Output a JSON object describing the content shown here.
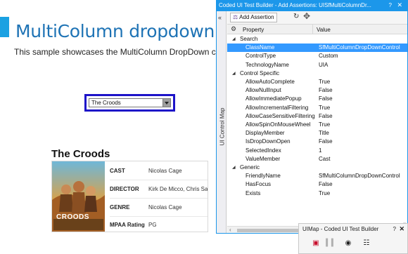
{
  "sample": {
    "title": "MultiColumn dropdown",
    "description": "This sample showcases the MultiColumn DropDown control.",
    "dropdown": {
      "selected_value": "The Croods"
    },
    "movie": {
      "title": "The Croods",
      "poster_text": "CROODS",
      "details": [
        {
          "key": "CAST",
          "value": "Nicolas Cage"
        },
        {
          "key": "DIRECTOR",
          "value": "Kirk De Micco, Chris Sanders"
        },
        {
          "key": "GENRE",
          "value": "Nicolas Cage"
        },
        {
          "key": "MPAA Rating",
          "value": "PG"
        }
      ]
    }
  },
  "builder": {
    "title": "Coded UI Test Builder - Add Assertions: UISfMultiColumnDr...",
    "help": "?",
    "close": "✕",
    "collapse": "«",
    "side_label": "UI Control Map",
    "toolbar": {
      "add_assertion": "Add Assertion"
    },
    "grid": {
      "col_property": "Property",
      "col_value": "Value",
      "rows": [
        {
          "kind": "cat",
          "label": "Search"
        },
        {
          "kind": "prop",
          "name": "ClassName",
          "value": "SfMultiColumnDropDownControl",
          "selected": true
        },
        {
          "kind": "prop",
          "name": "ControlType",
          "value": "Custom"
        },
        {
          "kind": "prop",
          "name": "TechnologyName",
          "value": "UIA"
        },
        {
          "kind": "cat",
          "label": "Control Specific"
        },
        {
          "kind": "prop",
          "name": "AllowAutoComplete",
          "value": "True"
        },
        {
          "kind": "prop",
          "name": "AllowNullInput",
          "value": "False"
        },
        {
          "kind": "prop",
          "name": "AllowImmediatePopup",
          "value": "False"
        },
        {
          "kind": "prop",
          "name": "AllowIncrementalFiltering",
          "value": "True"
        },
        {
          "kind": "prop",
          "name": "AllowCaseSensitiveFiltering",
          "value": "False"
        },
        {
          "kind": "prop",
          "name": "AllowSpinOnMouseWheel",
          "value": "True"
        },
        {
          "kind": "prop",
          "name": "DisplayMember",
          "value": "Title"
        },
        {
          "kind": "prop",
          "name": "IsDropDownOpen",
          "value": "False"
        },
        {
          "kind": "prop",
          "name": "SelectedIndex",
          "value": "1"
        },
        {
          "kind": "prop",
          "name": "ValueMember",
          "value": "Cast"
        },
        {
          "kind": "cat",
          "label": "Generic"
        },
        {
          "kind": "prop",
          "name": "FriendlyName",
          "value": "SfMultiColumnDropDownControl"
        },
        {
          "kind": "prop",
          "name": "HasFocus",
          "value": "False"
        },
        {
          "kind": "prop",
          "name": "Exists",
          "value": "True"
        }
      ]
    }
  },
  "uimap": {
    "title": "UIMap - Coded UI Test Builder",
    "help": "?",
    "close": "✕"
  },
  "colors": {
    "accent": "#1ba1e2",
    "title_blue": "#1e73b5",
    "builder_blue": "#1c97ea",
    "selection": "#3399ff",
    "focus_border": "#1d13c8"
  }
}
